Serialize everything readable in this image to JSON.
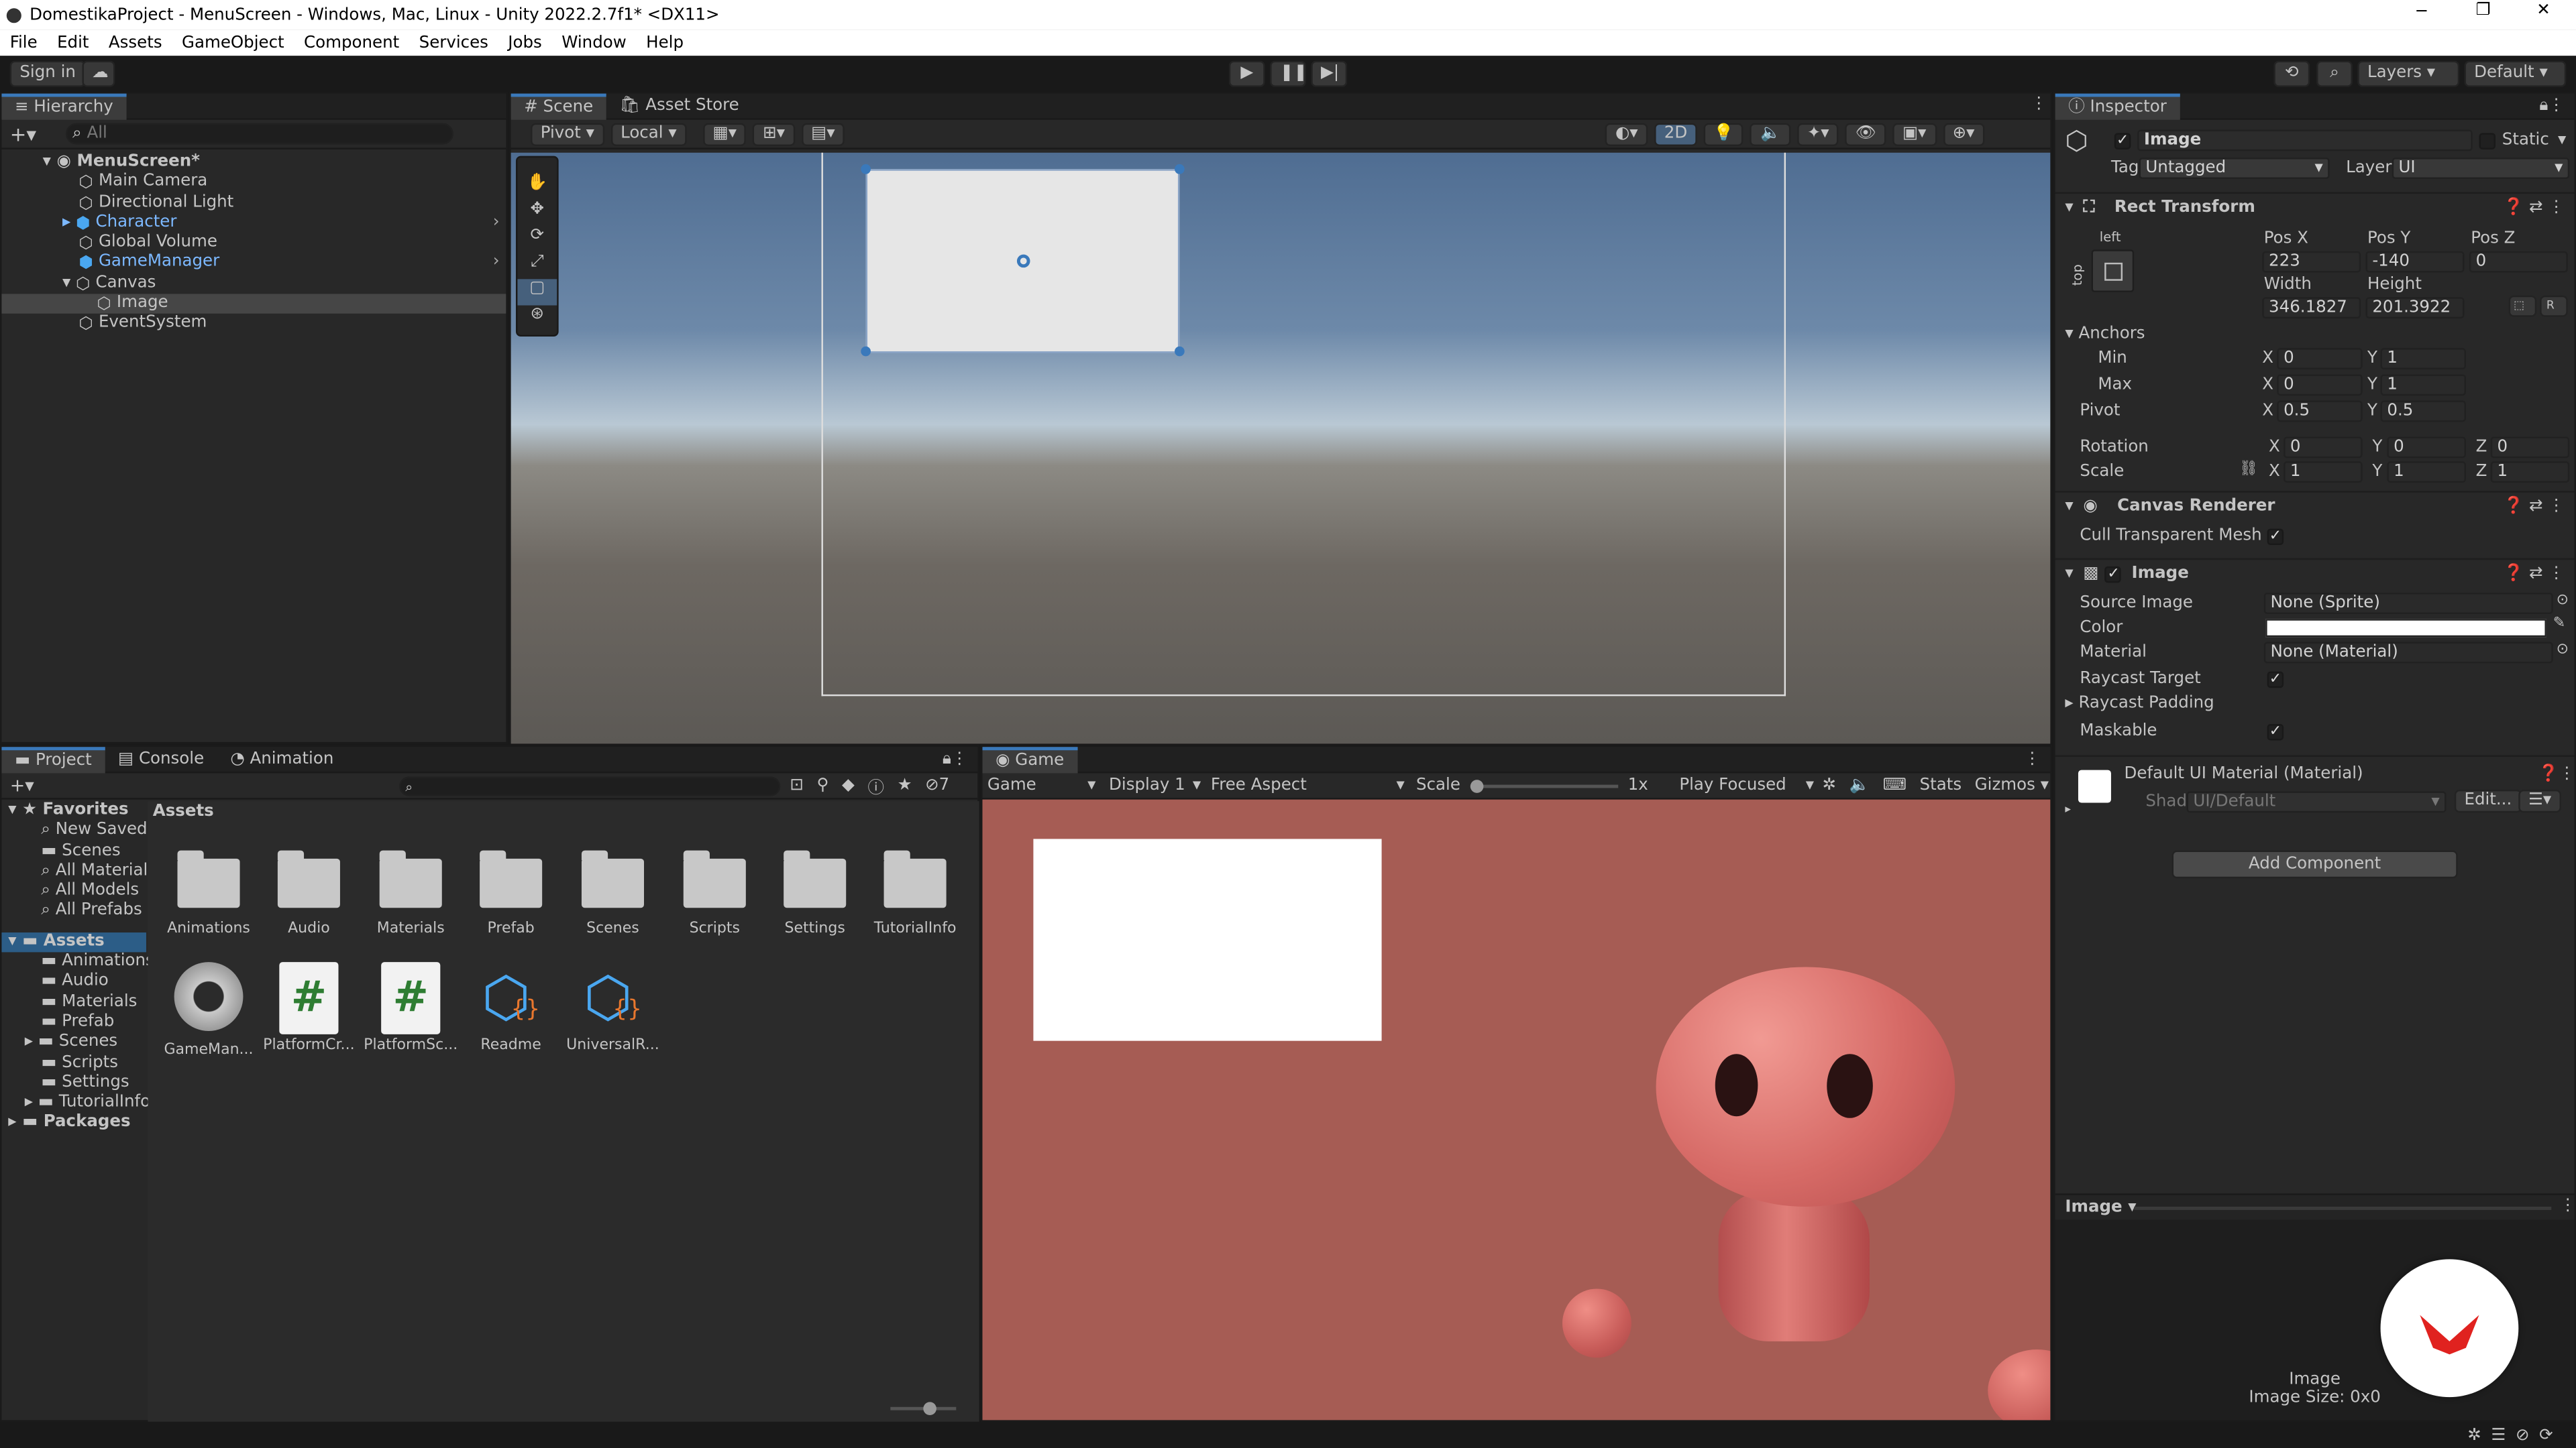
{
  "window": {
    "title": "DomestikaProject - MenuScreen - Windows, Mac, Linux - Unity 2022.2.7f1* <DX11>"
  },
  "menu": [
    "File",
    "Edit",
    "Assets",
    "GameObject",
    "Component",
    "Services",
    "Jobs",
    "Window",
    "Help"
  ],
  "toolbar": {
    "sign_in": "Sign in",
    "layers": "Layers",
    "layout": "Default"
  },
  "hierarchy": {
    "tab": "Hierarchy",
    "search_placeholder": "All",
    "scene": "MenuScreen*",
    "items": [
      "Main Camera",
      "Directional Light",
      "Character",
      "Global Volume",
      "GameManager",
      "Canvas",
      "Image",
      "EventSystem"
    ]
  },
  "scene": {
    "tabs": [
      "Scene",
      "Asset Store"
    ],
    "pivot": "Pivot",
    "local": "Local",
    "mode_2d": "2D"
  },
  "project": {
    "tabs": [
      "Project",
      "Console",
      "Animation"
    ],
    "favorites": {
      "label": "Favorites",
      "items": [
        "New Saved",
        "Scenes",
        "All Materials",
        "All Models",
        "All Prefabs"
      ]
    },
    "assets": {
      "label": "Assets",
      "items": [
        "Animations",
        "Audio",
        "Materials",
        "Prefab",
        "Scenes",
        "Scripts",
        "Settings",
        "TutorialInfo"
      ]
    },
    "packages": "Packages",
    "breadcrumb": "Assets",
    "hidden_count": "7",
    "folders": [
      "Animations",
      "Audio",
      "Materials",
      "Prefab",
      "Scenes",
      "Scripts",
      "Settings",
      "TutorialInfo"
    ],
    "files": [
      "GameMan...",
      "PlatformCr...",
      "PlatformSc...",
      "Readme",
      "UniversalR..."
    ]
  },
  "game": {
    "tab": "Game",
    "view": "Game",
    "display": "Display 1",
    "aspect": "Free Aspect",
    "scale_label": "Scale",
    "scale_value": "1x",
    "play_mode": "Play Focused",
    "stats": "Stats",
    "gizmos": "Gizmos"
  },
  "inspector": {
    "tab": "Inspector",
    "object_name": "Image",
    "static": "Static",
    "tag_label": "Tag",
    "tag": "Untagged",
    "layer_label": "Layer",
    "layer": "UI",
    "rect_transform": {
      "title": "Rect Transform",
      "anchor_h": "left",
      "anchor_v": "top",
      "labels": {
        "posx": "Pos X",
        "posy": "Pos Y",
        "posz": "Pos Z",
        "width": "Width",
        "height": "Height"
      },
      "pos_x": "223",
      "pos_y": "-140",
      "pos_z": "0",
      "width": "346.1827",
      "height": "201.3922",
      "anchors_label": "Anchors",
      "min_label": "Min",
      "min_x": "0",
      "min_y": "1",
      "max_label": "Max",
      "max_x": "0",
      "max_y": "1",
      "pivot_label": "Pivot",
      "pivot_x": "0.5",
      "pivot_y": "0.5",
      "rotation_label": "Rotation",
      "rot_x": "0",
      "rot_y": "0",
      "rot_z": "0",
      "scale_label": "Scale",
      "scale_x": "1",
      "scale_y": "1",
      "scale_z": "1"
    },
    "canvas_renderer": {
      "title": "Canvas Renderer",
      "cull_label": "Cull Transparent Mesh"
    },
    "image": {
      "title": "Image",
      "source_label": "Source Image",
      "source": "None (Sprite)",
      "color_label": "Color",
      "material_label": "Material",
      "material": "None (Material)",
      "raycast_label": "Raycast Target",
      "padding_label": "Raycast Padding",
      "maskable_label": "Maskable"
    },
    "material_block": {
      "title": "Default UI Material (Material)",
      "shader_label": "Shader",
      "shader": "UI/Default",
      "edit": "Edit..."
    },
    "add_component": "Add Component",
    "preview": {
      "title": "Image",
      "caption": "Image",
      "size": "Image Size: 0x0"
    }
  },
  "colors": {
    "accent": "#3a79bb",
    "game_bg": "#a65c54",
    "character": "#d46b6b"
  }
}
